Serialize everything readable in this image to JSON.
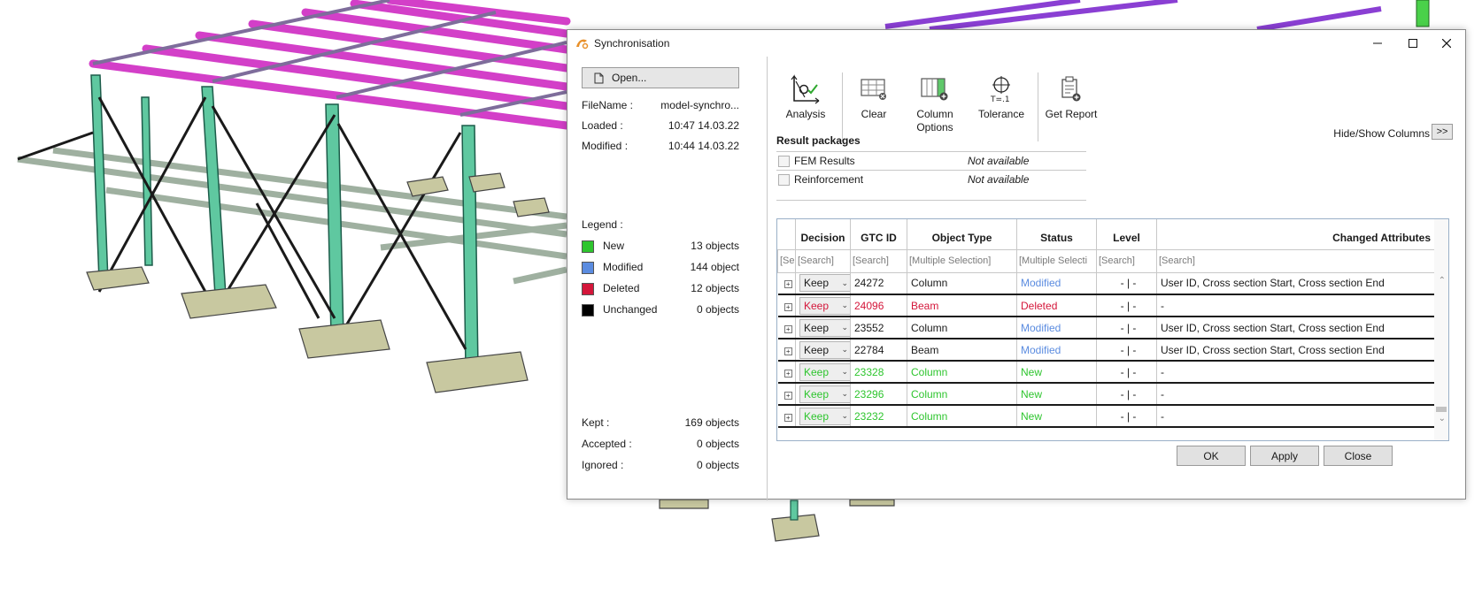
{
  "dialog": {
    "title": "Synchronisation",
    "open_label": "Open...",
    "file_name_label": "FileName :",
    "file_name_value": "model-synchro...",
    "loaded_label": "Loaded :",
    "loaded_value": "10:47 14.03.22",
    "modified_label": "Modified :",
    "modified_value": "10:44 14.03.22",
    "legend_title": "Legend :",
    "legend": [
      {
        "label": "New",
        "count": "13 objects",
        "color": "#2ec52e"
      },
      {
        "label": "Modified",
        "count": "144 object",
        "color": "#5b8ce0"
      },
      {
        "label": "Deleted",
        "count": "12 objects",
        "color": "#d4163a"
      },
      {
        "label": "Unchanged",
        "count": "0 objects",
        "color": "#000000"
      }
    ],
    "stats": [
      {
        "label": "Kept :",
        "value": "169 objects"
      },
      {
        "label": "Accepted :",
        "value": "0 objects"
      },
      {
        "label": "Ignored :",
        "value": "0 objects"
      }
    ],
    "toolbar": [
      {
        "label": "Analysis",
        "icon": "analysis-icon"
      },
      {
        "label": "Clear",
        "icon": "clear-icon"
      },
      {
        "label": "Column Options",
        "icon": "column-options-icon"
      },
      {
        "label": "Tolerance",
        "icon": "tolerance-icon"
      },
      {
        "label": "Get Report",
        "icon": "report-icon"
      }
    ],
    "hide_show_label": "Hide/Show Columns",
    "hide_show_button": ">>",
    "result_packages_title": "Result packages",
    "result_packages": [
      {
        "name": "FEM Results",
        "status": "Not available"
      },
      {
        "name": "Reinforcement",
        "status": "Not available"
      }
    ],
    "grid": {
      "headers": [
        "",
        "Decision",
        "GTC ID",
        "Object Type",
        "Status",
        "Level",
        "Changed Attributes"
      ],
      "filters": [
        "[Se",
        "[Search]",
        "[Search]",
        "[Multiple Selection]",
        "[Multiple Selecti",
        "[Search]",
        "[Search]"
      ],
      "status_colors": {
        "Modified": "#5b8ce0",
        "Deleted": "#d4163a",
        "New": "#2ec52e"
      },
      "rows": [
        {
          "decision": "Keep",
          "id": "24272",
          "type": "Column",
          "status": "Modified",
          "level": "- | -",
          "attrs": "User ID, Cross section Start, Cross section End"
        },
        {
          "decision": "Keep",
          "id": "24096",
          "type": "Beam",
          "status": "Deleted",
          "level": "- | -",
          "attrs": "-"
        },
        {
          "decision": "Keep",
          "id": "23552",
          "type": "Column",
          "status": "Modified",
          "level": "- | -",
          "attrs": "User ID, Cross section Start, Cross section End"
        },
        {
          "decision": "Keep",
          "id": "22784",
          "type": "Beam",
          "status": "Modified",
          "level": "- | -",
          "attrs": "User ID, Cross section Start, Cross section End"
        },
        {
          "decision": "Keep",
          "id": "23328",
          "type": "Column",
          "status": "New",
          "level": "- | -",
          "attrs": "-"
        },
        {
          "decision": "Keep",
          "id": "23296",
          "type": "Column",
          "status": "New",
          "level": "- | -",
          "attrs": "-"
        },
        {
          "decision": "Keep",
          "id": "23232",
          "type": "Column",
          "status": "New",
          "level": "- | -",
          "attrs": "-"
        }
      ]
    },
    "buttons": {
      "ok": "OK",
      "apply": "Apply",
      "close": "Close"
    }
  }
}
